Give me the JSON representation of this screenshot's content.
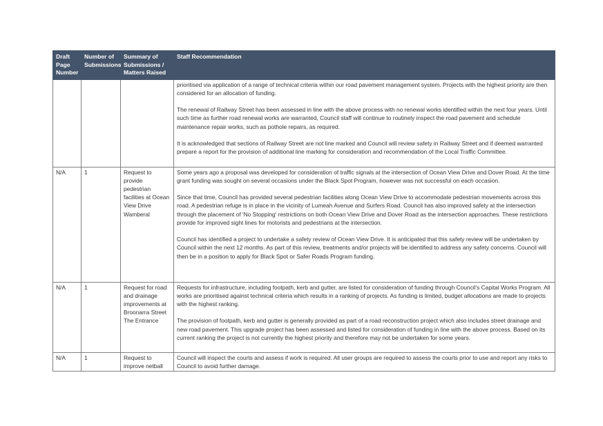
{
  "headers": [
    "Draft Page Number",
    "Number of Submissions",
    "Summary of Submissions / Matters Raised",
    "Staff Recommendation"
  ],
  "rows": [
    {
      "page": "",
      "number": "",
      "summary": "",
      "paragraphs": [
        "prioritised via application of a range of technical criteria within our road pavement management system. Projects with the highest priority are then considered for an allocation of funding.",
        "The renewal of Railway Street has been assessed in line with the above process with no renewal works identified within the next four years. Until such time as further road renewal works are warranted, Council staff will continue to routinely inspect the road pavement and schedule maintenance repair works, such as pothole repairs, as required.",
        "It is acknowledged that sections of Railway Street are not line marked and Council will review safety in Railway Street and if deemed warranted prepare a report for the provision of additional line marking for consideration and recommendation of the Local Traffic Committee."
      ]
    },
    {
      "page": "N/A",
      "number": "1",
      "summary": "Request to provide pedestrian facilities at Ocean View Drive Wamberal",
      "paragraphs": [
        "Some years ago a proposal was developed for consideration of traffic signals at the intersection of Ocean View Drive and Dover Road. At the time grant funding was sought on several occasions under the Black Spot Program, however was not successful on each occasion.",
        "Since that time, Council has provided several pedestrian facilities along Ocean View Drive to accommodate pedestrian movements across this road. A pedestrian refuge is in place in the vicinity of Lumeah Avenue and Surfers Road. Council has also improved safety at the intersection through the placement of 'No Stopping' restrictions on both Ocean View Drive and Dover Road as the intersection approaches. These restrictions provide for improved sight lines for motorists and pedestrians at the intersection.",
        "Council has identified a project to undertake a safety review of Ocean View Drive. It is anticipated that this safety review will be undertaken by Council within the next 12 months. As part of this review, treatments and/or projects will be identified to address any safety concerns. Council will then be in a position to apply for Black Spot or Safer Roads Program funding."
      ]
    },
    {
      "page": "N/A",
      "number": "1",
      "summary": "Request for road and drainage improvements at Broonarra Street The Entrance",
      "paragraphs": [
        "Requests for infrastructure, including footpath, kerb and gutter, are listed for consideration of funding through Council's Capital Works Program. All works are prioritised against technical criteria which results in a ranking of projects. As funding is limited, budget allocations are made to projects with the highest ranking.",
        "The provision of footpath, kerb and gutter is generally provided as part of a road reconstruction project which also includes street drainage and new road pavement. This upgrade project has been assessed and listed for consideration of funding in line with the above process. Based on its current ranking the project is not currently the highest priority and therefore may not be undertaken for some years."
      ]
    },
    {
      "page": "N/A",
      "number": "1",
      "summary": "Request to improve netball",
      "paragraphs": [
        "Council will inspect the courts and assess if work is required. All user groups are required to assess the courts prior to use and report any risks to Council to avoid further damage."
      ]
    }
  ]
}
